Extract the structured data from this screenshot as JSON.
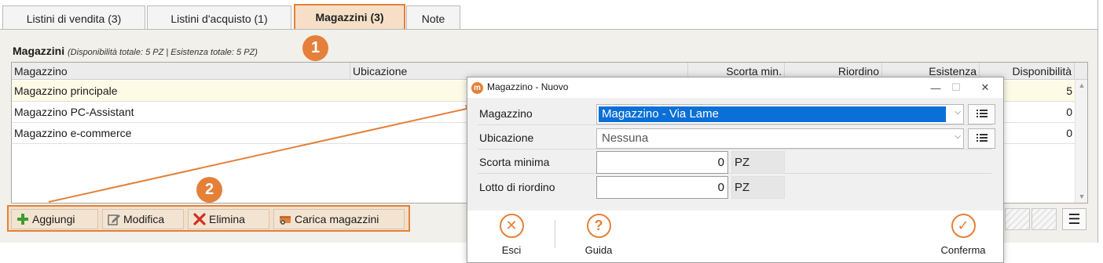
{
  "tabs": [
    {
      "label": "Listini di vendita (3)"
    },
    {
      "label": "Listini d'acquisto (1)"
    },
    {
      "label": "Magazzini (3)"
    },
    {
      "label": "Note"
    }
  ],
  "section": {
    "title": "Magazzini",
    "subtitle": "(Disponibilità totale: 5 PZ | Esistenza totale: 5 PZ)"
  },
  "grid": {
    "columns": [
      "Magazzino",
      "Ubicazione",
      "Scorta min.",
      "Riordino",
      "Esistenza",
      "Disponibilità"
    ],
    "rows": [
      {
        "magazzino": "Magazzino principale",
        "disponibilita": "5"
      },
      {
        "magazzino": "Magazzino PC-Assistant",
        "disponibilita": "0"
      },
      {
        "magazzino": "Magazzino e-commerce",
        "disponibilita": "0"
      }
    ]
  },
  "toolbar": {
    "aggiungi": "Aggiungi",
    "modifica": "Modifica",
    "elimina": "Elimina",
    "carica": "Carica magazzini"
  },
  "callouts": {
    "one": "1",
    "two": "2"
  },
  "dialog": {
    "title": "Magazzino - Nuovo",
    "fields": {
      "magazzino_label": "Magazzino",
      "magazzino_value": "Magazzino - Via Lame",
      "ubicazione_label": "Ubicazione",
      "ubicazione_value": "Nessuna",
      "scorta_label": "Scorta minima",
      "scorta_value": "0",
      "scorta_unit": "PZ",
      "lotto_label": "Lotto di riordino",
      "lotto_value": "0",
      "lotto_unit": "PZ"
    },
    "buttons": {
      "esci": "Esci",
      "guida": "Guida",
      "conferma": "Conferma"
    }
  },
  "colors": {
    "accent": "#e4803a",
    "accent_light": "#f6dfc6",
    "selection": "#0a6fd6",
    "panel": "#f2f0ea"
  },
  "icons": [
    "plus-icon",
    "edit-icon",
    "delete-icon",
    "load-warehouse-icon",
    "list-icon",
    "dropdown-arrow-icon",
    "close-icon",
    "help-icon",
    "check-icon",
    "menu-icon"
  ]
}
